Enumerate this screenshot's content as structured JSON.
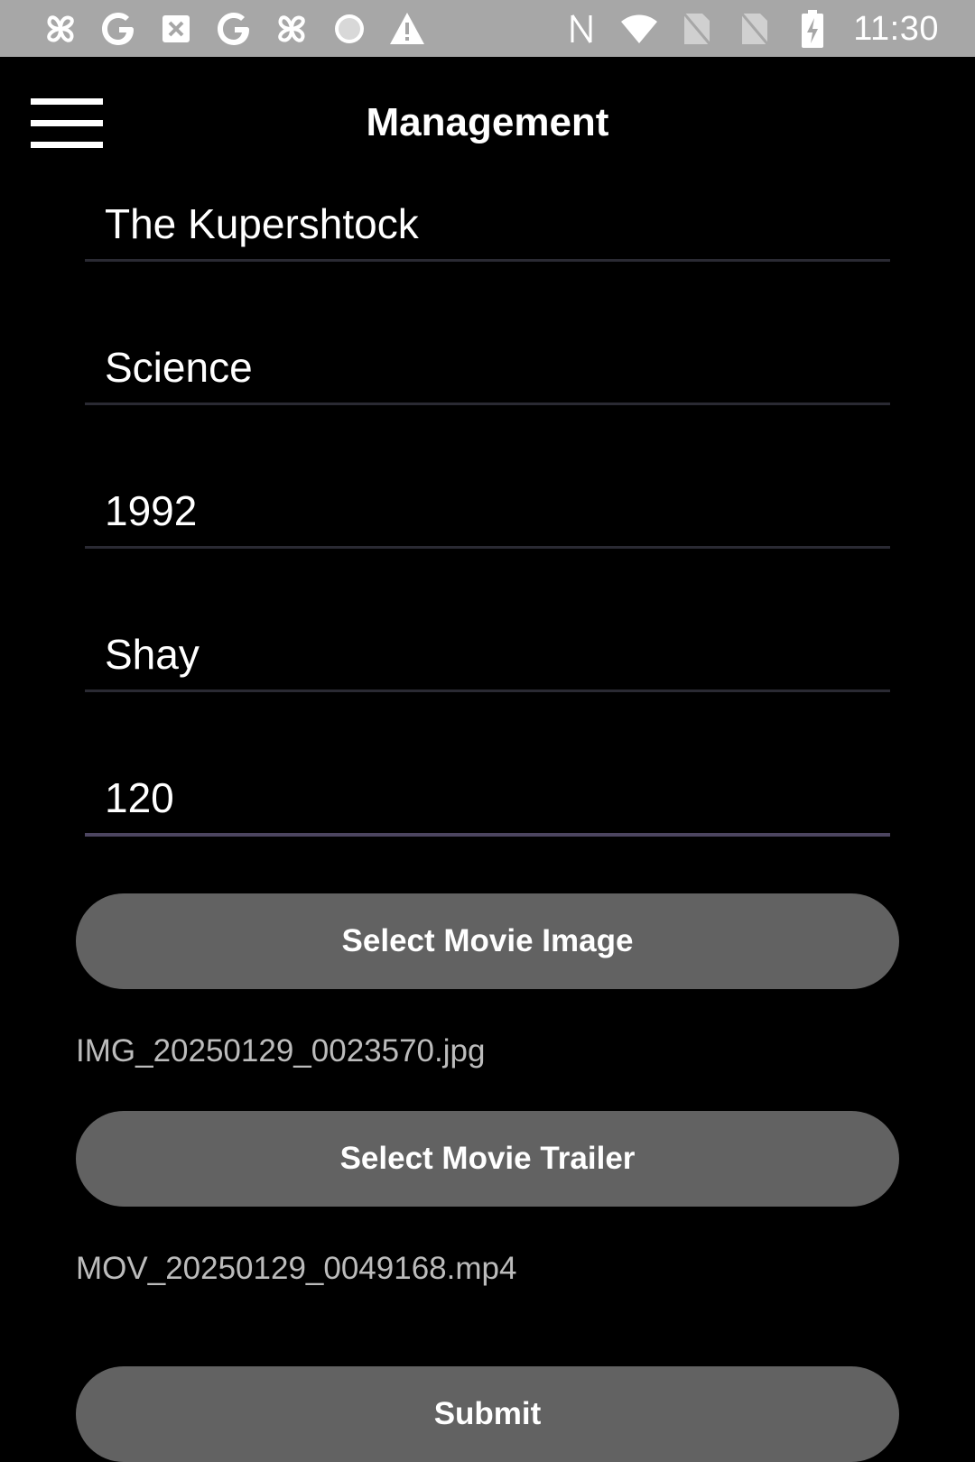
{
  "status_bar": {
    "time": "11:30",
    "left_icons": [
      "pinwheel-icon",
      "google-icon",
      "image-off-icon",
      "google-icon",
      "pinwheel-icon",
      "loading-spinner-icon",
      "warning-icon"
    ],
    "right_icons": [
      "nfc-icon",
      "wifi-icon",
      "no-sim-icon",
      "no-sim-icon",
      "battery-charging-icon"
    ]
  },
  "app_bar": {
    "title": "Management"
  },
  "form": {
    "title_value": "The Kupershtock",
    "genre_value": "Science",
    "year_value": "1992",
    "director_value": "Shay",
    "duration_value": "120"
  },
  "buttons": {
    "select_image": "Select Movie Image",
    "select_trailer": "Select Movie Trailer",
    "submit": "Submit"
  },
  "files": {
    "image": "IMG_20250129_0023570.jpg",
    "trailer": "MOV_20250129_0049168.mp4"
  },
  "colors": {
    "background": "#000000",
    "status_bar": "#a7a7a7",
    "button": "#626262",
    "focused_underline": "#4c4560"
  }
}
